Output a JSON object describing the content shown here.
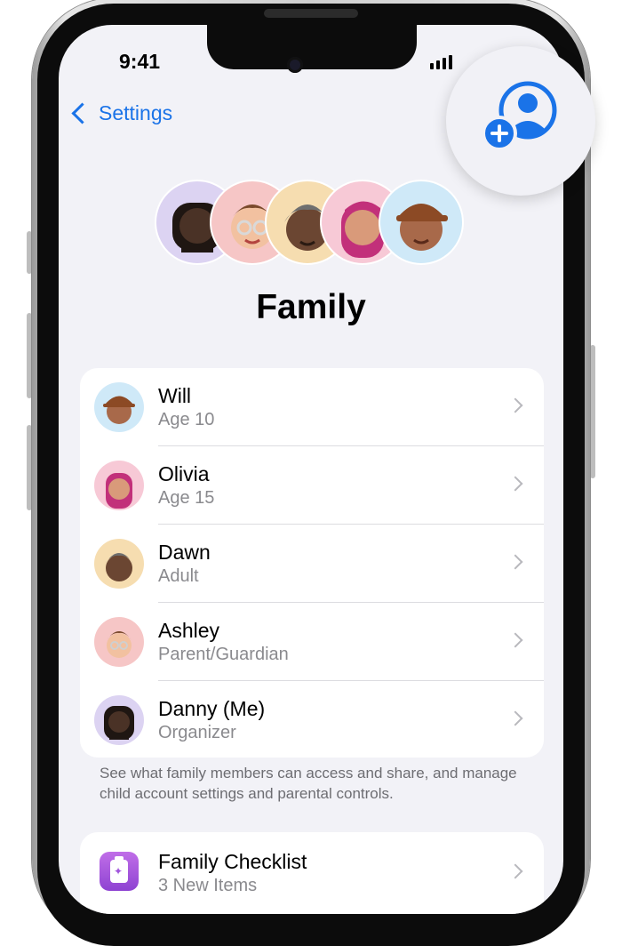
{
  "status_bar": {
    "time": "9:41"
  },
  "nav": {
    "back_label": "Settings",
    "add_member_icon": "person-add-icon"
  },
  "header": {
    "title": "Family"
  },
  "members": [
    {
      "name": "Will",
      "subtitle": "Age 10",
      "avatar": "memoji-will",
      "bg": "#cfe9f8"
    },
    {
      "name": "Olivia",
      "subtitle": "Age 15",
      "avatar": "memoji-olivia",
      "bg": "#f7c9d6"
    },
    {
      "name": "Dawn",
      "subtitle": "Adult",
      "avatar": "memoji-dawn",
      "bg": "#f6ddb0"
    },
    {
      "name": "Ashley",
      "subtitle": "Parent/Guardian",
      "avatar": "memoji-ashley",
      "bg": "#f6c6c6"
    },
    {
      "name": "Danny (Me)",
      "subtitle": "Organizer",
      "avatar": "memoji-danny",
      "bg": "#dcd3f2"
    }
  ],
  "footer_text": "See what family members can access and share, and manage child account settings and parental controls.",
  "checklist": {
    "title": "Family Checklist",
    "subtitle": "3 New Items",
    "icon": "checklist-icon"
  },
  "colors": {
    "accent": "#1a73e8",
    "background": "#f2f2f7",
    "secondary_text": "#8a8a8e"
  }
}
